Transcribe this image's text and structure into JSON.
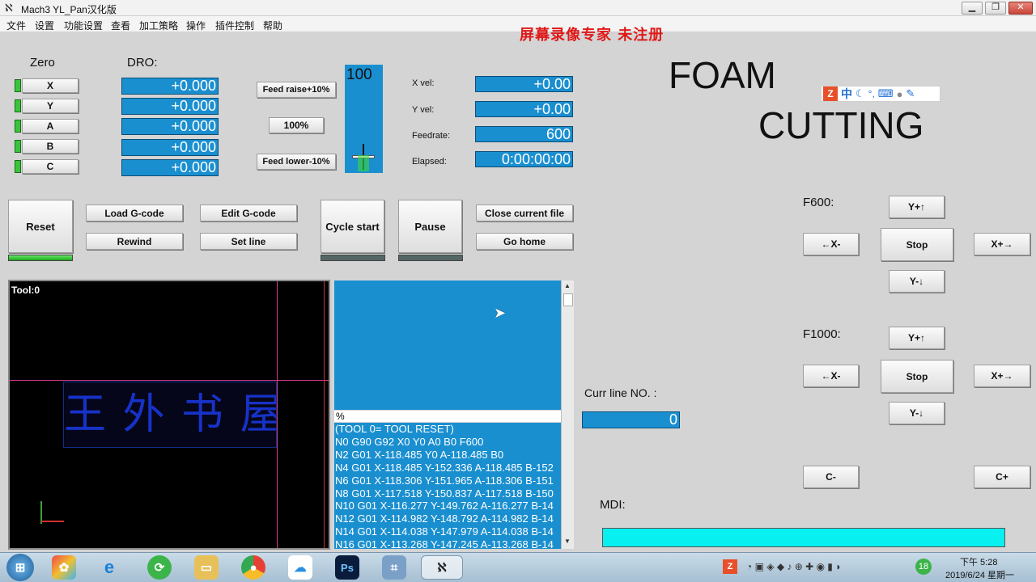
{
  "window": {
    "title": "Mach3 YL_Pan汉化版",
    "min": "▁",
    "restore": "❐",
    "close": "✕"
  },
  "menu": [
    "文件",
    "设置",
    "功能设置",
    "查看",
    "加工策略",
    "操作",
    "插件控制",
    "帮助"
  ],
  "watermark": "屏幕录像专家  未注册",
  "zero": {
    "label": "Zero",
    "axes": [
      "X",
      "Y",
      "A",
      "B",
      "C"
    ]
  },
  "dro": {
    "label": "DRO:",
    "values": [
      "+0.000",
      "+0.000",
      "+0.000",
      "+0.000",
      "+0.000"
    ]
  },
  "feed": {
    "raise_label": "Feed raise+10%",
    "pct_label": "100%",
    "lower_label": "Feed lower-10%",
    "override_value": "100",
    "override_level": 0.0
  },
  "status": {
    "xvel_label": "X vel:",
    "xvel": "+0.00",
    "yvel_label": "Y vel:",
    "yvel": "+0.00",
    "feedrate_label": "Feedrate:",
    "feedrate": "600",
    "elapsed_label": "Elapsed:",
    "elapsed": "0:00:00:00"
  },
  "banner": {
    "line1": "FOAM",
    "line2": "CUTTING"
  },
  "ime_icons": [
    "ime-logo-icon",
    "chinese-mode-icon",
    "moon-icon",
    "punctuation-icon",
    "keyboard-icon",
    "user-icon",
    "wrench-icon"
  ],
  "ime_chinese": "中",
  "buttons": {
    "reset": "Reset",
    "load_gcode": "Load G-code",
    "edit_gcode": "Edit G-code",
    "rewind": "Rewind",
    "set_line": "Set line",
    "cycle_start": "Cycle start",
    "pause": "Pause",
    "close_file": "Close current file",
    "go_home": "Go home"
  },
  "jog": {
    "f600_label": "F600:",
    "f1000_label": "F1000:",
    "y_plus": "Y+↑",
    "y_minus": "Y-↓",
    "x_minus": "←X-",
    "x_plus": "X+→",
    "stop": "Stop",
    "c_minus": "C-",
    "c_plus": "C+"
  },
  "toolpath": {
    "tool_label": "Tool:0",
    "text_art": "王 外 书 屋"
  },
  "gcode": {
    "percent": "%",
    "lines": [
      "(TOOL 0= TOOL RESET)",
      "N0 G90 G92 X0 Y0 A0 B0 F600",
      "N2 G01 X-118.485 Y0 A-118.485 B0",
      "N4 G01 X-118.485 Y-152.336 A-118.485 B-152",
      "N6 G01 X-118.306 Y-151.965 A-118.306 B-151",
      "N8 G01 X-117.518 Y-150.837 A-117.518 B-150",
      "N10 G01 X-116.277 Y-149.762 A-116.277 B-14",
      "N12 G01 X-114.982 Y-148.792 A-114.982 B-14",
      "N14 G01 X-114.038 Y-147.979 A-114.038 B-14",
      "N16 G01 X-113.268 Y-147.245 A-113.268 B-14"
    ]
  },
  "curr_line": {
    "label": "Curr line NO. :",
    "value": "0"
  },
  "mdi": {
    "label": "MDI:",
    "value": ""
  },
  "taskbar": {
    "apps": [
      "start-icon",
      "colorful-app-icon",
      "ie-icon",
      "refresh-app-icon",
      "folder-icon",
      "chrome-icon",
      "cloud-app-icon",
      "photoshop-icon",
      "network-app-icon",
      "mach3-icon"
    ],
    "ps": "Ps",
    "badge": "18",
    "time": "下午 5:28",
    "date": "2019/6/24 星期一"
  },
  "colors": {
    "dro_blue": "#1a8fd0",
    "mdi_cyan": "#08f0f0",
    "led_green": "#3ac43a"
  }
}
